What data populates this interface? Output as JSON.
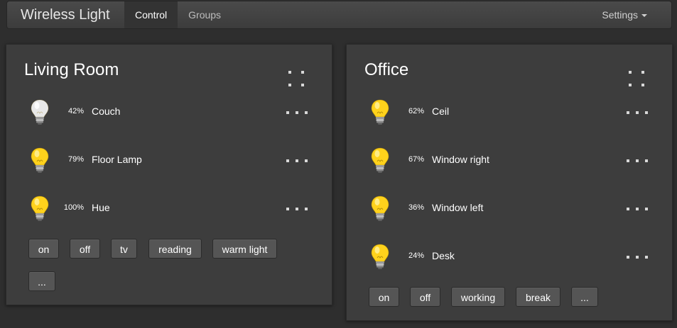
{
  "navbar": {
    "brand": "Wireless Light",
    "tabs": [
      {
        "label": "Control",
        "active": true
      },
      {
        "label": "Groups",
        "active": false
      }
    ],
    "settings_label": "Settings"
  },
  "rooms": [
    {
      "title": "Living Room",
      "lights": [
        {
          "percent": "42%",
          "name": "Couch",
          "on": false
        },
        {
          "percent": "79%",
          "name": "Floor Lamp",
          "on": true
        },
        {
          "percent": "100%",
          "name": "Hue",
          "on": true
        }
      ],
      "scenes": [
        "on",
        "off",
        "tv",
        "reading",
        "warm light",
        "..."
      ]
    },
    {
      "title": "Office",
      "lights": [
        {
          "percent": "62%",
          "name": "Ceil",
          "on": true
        },
        {
          "percent": "67%",
          "name": "Window right",
          "on": true
        },
        {
          "percent": "36%",
          "name": "Window left",
          "on": true
        },
        {
          "percent": "24%",
          "name": "Desk",
          "on": true
        }
      ],
      "scenes": [
        "on",
        "off",
        "working",
        "break",
        "..."
      ]
    }
  ],
  "colors": {
    "background": "#2e2e2e",
    "panel": "#3d3d3d",
    "bulb_on": "#ffd21c",
    "bulb_off": "#e8e8e8",
    "button": "#555555"
  },
  "icons": {
    "bulb": "lightbulb-icon",
    "menu": "more-dots-icon",
    "drag": "drag-handle-icon"
  }
}
